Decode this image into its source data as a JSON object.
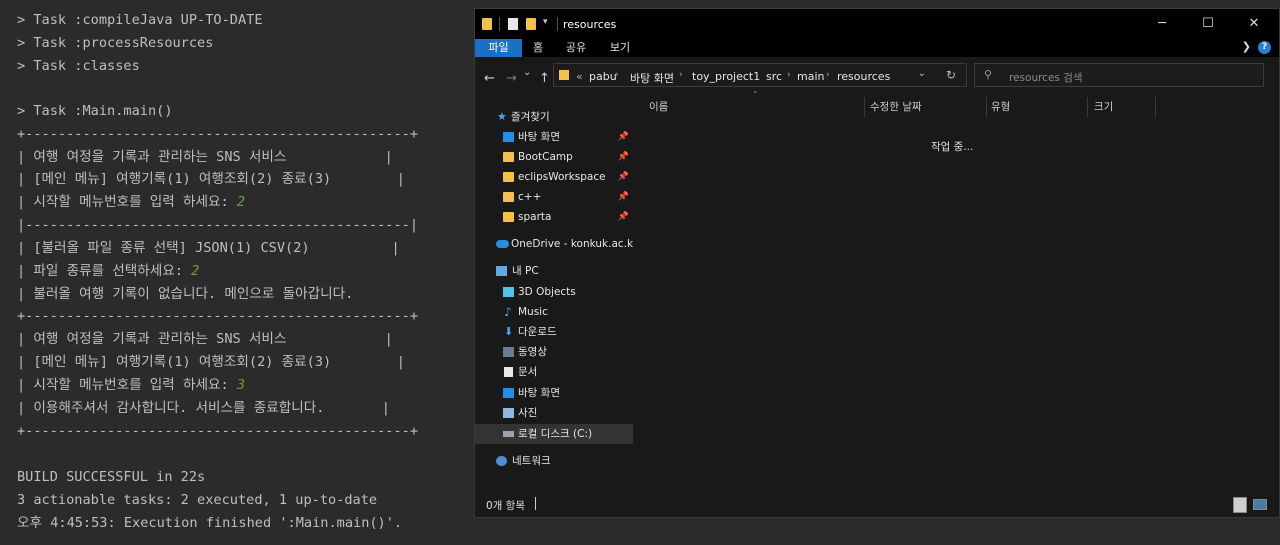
{
  "terminal": {
    "lines": [
      "> Task :compileJava UP-TO-DATE",
      "> Task :processResources",
      "> Task :classes",
      "",
      "> Task :Main.main()",
      "+-----------------------------------------------+",
      "| 여행 여정을 기록과 관리하는 SNS 서비스            |",
      "| [메인 메뉴] 여행기록(1) 여행조회(2) 종료(3)        |",
      "| 시작할 메뉴번호를 입력 하세요: ",
      "|-----------------------------------------------|",
      "| [불러올 파일 종류 선택] JSON(1) CSV(2)          |",
      "| 파일 종류를 선택하세요: ",
      "| 불러올 여행 기록이 없습니다. 메인으로 돌아갑니다.",
      "+-----------------------------------------------+",
      "| 여행 여정을 기록과 관리하는 SNS 서비스            |",
      "| [메인 메뉴] 여행기록(1) 여행조회(2) 종료(3)        |",
      "| 시작할 메뉴번호를 입력 하세요: ",
      "| 이용해주셔서 감사합니다. 서비스를 종료합니다.       |",
      "+-----------------------------------------------+",
      "",
      "BUILD SUCCESSFUL in 22s",
      "3 actionable tasks: 2 executed, 1 up-to-date",
      "오후 4:45:53: Execution finished ':Main.main()'."
    ],
    "inputs": {
      "menu1": "2",
      "filetype": "2",
      "menu2": "3"
    }
  },
  "explorer": {
    "title": "resources",
    "window_buttons": {
      "minimize": "─",
      "maximize": "☐",
      "close": "✕"
    },
    "ribbon_tabs": [
      "파일",
      "홈",
      "공유",
      "보기"
    ],
    "help": "?",
    "nav": {
      "back": "←",
      "forward": "→",
      "dropdown": "⌄",
      "up": "↑"
    },
    "breadcrumb": [
      "pabu",
      "바탕 화면",
      "toy_project1",
      "src",
      "main",
      "resources"
    ],
    "breadcrumb_lead": "«",
    "search_placeholder": "resources 검색",
    "columns": [
      "이름",
      "수정한 날짜",
      "유형",
      "크기"
    ],
    "loading_text": "작업 중...",
    "nav_items": [
      {
        "label": "즐겨찾기",
        "icon": "star-icon"
      },
      {
        "label": "바탕 화면",
        "icon": "desktop-icon",
        "pinned": true
      },
      {
        "label": "BootCamp",
        "icon": "folder-icon",
        "pinned": true
      },
      {
        "label": "eclipsWorkspace",
        "icon": "folder-icon",
        "pinned": true
      },
      {
        "label": "c++",
        "icon": "folder-icon",
        "pinned": true
      },
      {
        "label": "sparta",
        "icon": "folder-icon",
        "pinned": true
      },
      {
        "label": "OneDrive - konkuk.ac.kr",
        "icon": "cloud-icon"
      },
      {
        "label": "내 PC",
        "icon": "pc-icon"
      },
      {
        "label": "3D Objects",
        "icon": "cube-icon"
      },
      {
        "label": "Music",
        "icon": "music-icon"
      },
      {
        "label": "다운로드",
        "icon": "download-icon"
      },
      {
        "label": "동영상",
        "icon": "video-icon"
      },
      {
        "label": "문서",
        "icon": "document-icon"
      },
      {
        "label": "바탕 화면",
        "icon": "desktop-icon"
      },
      {
        "label": "사진",
        "icon": "picture-icon"
      },
      {
        "label": "로컬 디스크 (C:)",
        "icon": "drive-icon",
        "selected": true
      },
      {
        "label": "네트워크",
        "icon": "network-icon"
      }
    ],
    "status": "0개 항목",
    "colors": {
      "accent": "#1a6fc6",
      "folder": "#f2c14e",
      "pc_blue": "#2a8de0"
    }
  }
}
